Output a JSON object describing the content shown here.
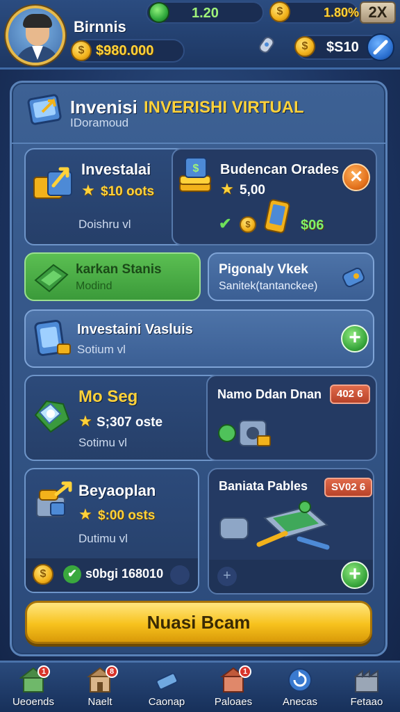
{
  "header": {
    "player_name": "Birnnis",
    "coins": "$980.000",
    "gems": "1.20",
    "gold": "1.80%",
    "close_label": "2X",
    "wallet": "$S10"
  },
  "panel": {
    "title_white": "Invenisi",
    "title_gold": "INVERISHI VIRTUAL",
    "subtitle": "IDoramoud"
  },
  "cards": {
    "investalai": {
      "title": "Investalai",
      "value": "$10 oots",
      "sub": "Doishru vl"
    },
    "budencan": {
      "title": "Budencan Orades",
      "value": "5,00",
      "reward": "$06"
    },
    "karkan": {
      "title": "karkan Stanis",
      "sub": "Modind"
    },
    "pigonaly": {
      "title": "Pigonaly Vkek",
      "sub": "Sanitek(tantanckee)"
    },
    "investaini": {
      "title": "Investaini Vasluis",
      "sub": "Sotium vl"
    },
    "mo_seg": {
      "title": "Mo Seg",
      "value": "S;307 oste",
      "sub": "Sotimu vl"
    },
    "namo": {
      "title": "Namo Ddan Dnan",
      "badge": "402 6"
    },
    "beyaoplan": {
      "title": "Beyaoplan",
      "value": "$:00 osts",
      "sub": "Dutimu vl",
      "footer": "s0bgi 168010"
    },
    "baniata": {
      "title": "Baniata Pables",
      "badge": "SV02 6"
    }
  },
  "cta_label": "Nuasi Bcam",
  "nav": [
    {
      "label": "Ueoends",
      "badge": "1"
    },
    {
      "label": "Naelt",
      "badge": "8"
    },
    {
      "label": "Caonap",
      "badge": ""
    },
    {
      "label": "Paloaes",
      "badge": "1"
    },
    {
      "label": "Anecas",
      "badge": ""
    },
    {
      "label": "Fetaao",
      "badge": ""
    }
  ],
  "colors": {
    "gold": "#ffd23a",
    "panel": "#3d6194",
    "plus_green": "#37a53b",
    "close_orange": "#e2701b"
  }
}
